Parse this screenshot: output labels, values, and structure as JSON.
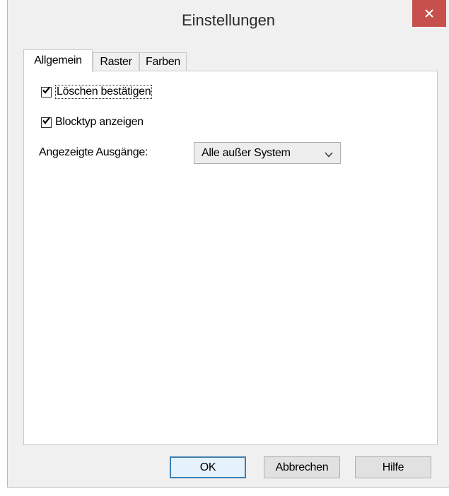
{
  "window": {
    "title": "Einstellungen",
    "close_symbol": "×"
  },
  "tabs": [
    {
      "label": "Allgemein",
      "active": true
    },
    {
      "label": "Raster",
      "active": false
    },
    {
      "label": "Farben",
      "active": false
    }
  ],
  "general": {
    "confirm_delete": {
      "label": "Löschen bestätigen",
      "checked": true
    },
    "show_block_type": {
      "label": "Blocktyp anzeigen",
      "checked": true
    },
    "outputs": {
      "label": "Angezeigte Ausgänge:",
      "selected": "Alle außer System"
    }
  },
  "buttons": {
    "ok": "OK",
    "cancel": "Abbrechen",
    "help": "Hilfe"
  },
  "colors": {
    "close_button": "#c7504c",
    "dialog_background": "#f0f0f0",
    "panel_background": "#ffffff",
    "default_button_border": "#3c7fb1"
  },
  "icons": {
    "close": "close-icon",
    "checkmark": "checkmark-icon",
    "dropdown": "chevron-down-icon"
  }
}
